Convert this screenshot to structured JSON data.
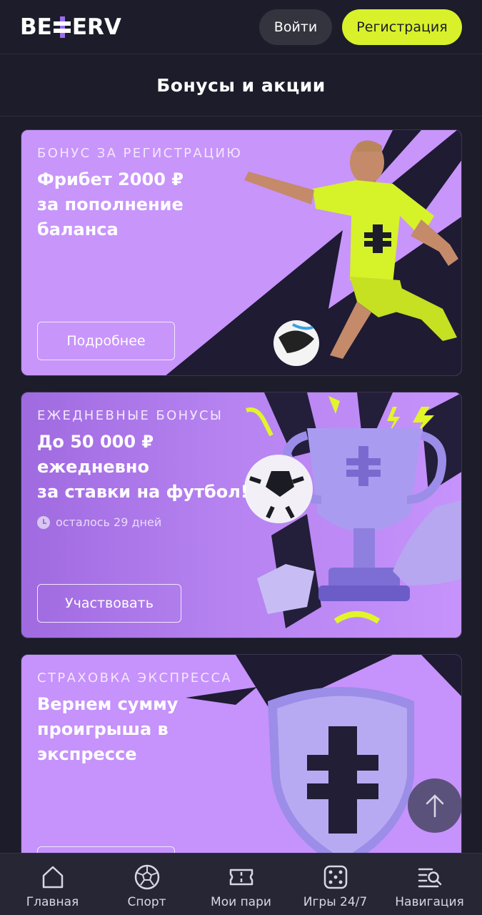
{
  "header": {
    "logo_text_left": "BE",
    "logo_text_right": "ERV",
    "login_label": "Войти",
    "register_label": "Регистрация"
  },
  "page": {
    "title": "Бонусы и акции"
  },
  "promos": [
    {
      "eyebrow": "БОНУС ЗА РЕГИСТРАЦИЮ",
      "headline_lines": [
        "Фрибет 2000 ₽",
        "за пополнение",
        "баланса"
      ],
      "cta": "Подробнее"
    },
    {
      "eyebrow": "ЕЖЕДНЕВНЫЕ БОНУСЫ",
      "headline_lines": [
        "До 50 000 ₽",
        "ежедневно",
        "за ставки на футбол!"
      ],
      "timer": "осталось 29 дней",
      "cta": "Участвовать"
    },
    {
      "eyebrow": "СТРАХОВКА ЭКСПРЕССА",
      "headline_lines": [
        "Вернем сумму",
        "проигрыша в",
        "экспрессе"
      ],
      "cta": ""
    }
  ],
  "bottom_nav": [
    {
      "label": "Главная",
      "icon": "home-icon"
    },
    {
      "label": "Спорт",
      "icon": "soccer-ball-icon"
    },
    {
      "label": "Мои пари",
      "icon": "ticket-icon"
    },
    {
      "label": "Игры 24/7",
      "icon": "dice-icon"
    },
    {
      "label": "Навигация",
      "icon": "menu-search-icon"
    }
  ],
  "colors": {
    "background": "#1c1c2a",
    "accent_lime": "#d8f12a",
    "card_purple": "#c692fb",
    "brand_purple": "#9b6cf0"
  }
}
